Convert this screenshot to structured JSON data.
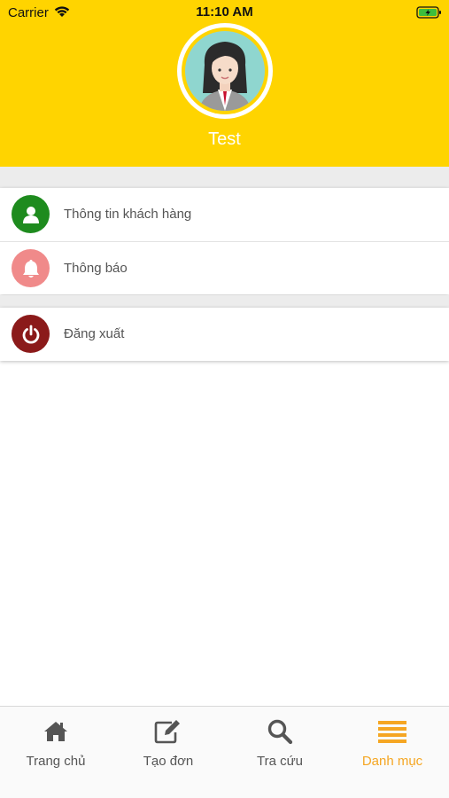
{
  "status_bar": {
    "carrier": "Carrier",
    "time": "11:10 AM"
  },
  "profile": {
    "name": "Test"
  },
  "menu": {
    "items": [
      {
        "label": "Thông tin khách hàng",
        "icon": "user-icon",
        "color": "#1E8B1E"
      },
      {
        "label": "Thông báo",
        "icon": "bell-icon",
        "color": "#F08A8A"
      },
      {
        "label": "Đăng xuất",
        "icon": "power-icon",
        "color": "#8B1A1A"
      }
    ]
  },
  "tabbar": {
    "tabs": [
      {
        "label": "Trang chủ",
        "icon": "home-icon",
        "active": false
      },
      {
        "label": "Tạo đơn",
        "icon": "edit-icon",
        "active": false
      },
      {
        "label": "Tra cứu",
        "icon": "search-icon",
        "active": false
      },
      {
        "label": "Danh mục",
        "icon": "menu-icon",
        "active": true
      }
    ],
    "active_color": "#F5A623"
  },
  "colors": {
    "header": "#FFD400"
  }
}
